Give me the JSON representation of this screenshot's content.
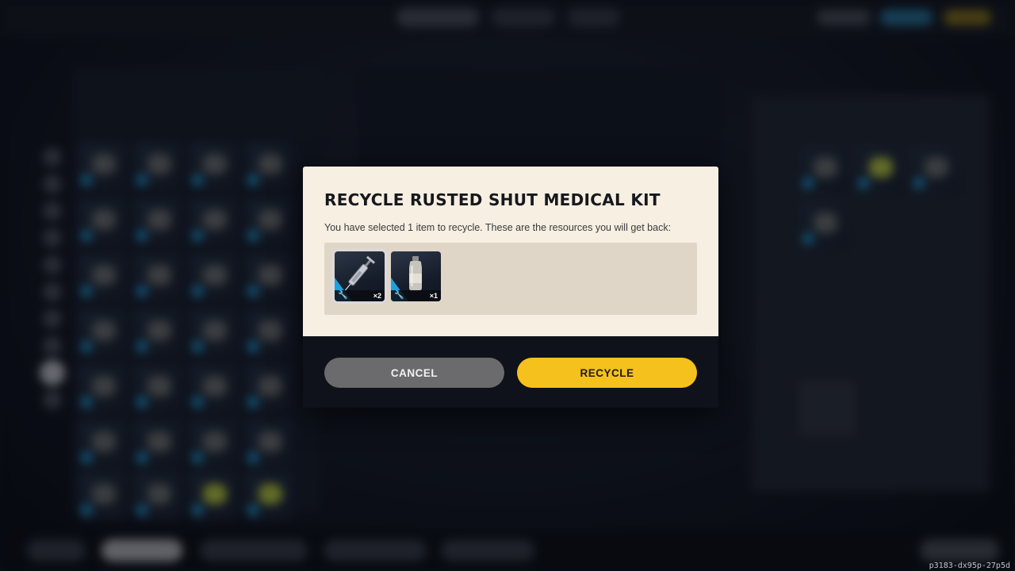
{
  "dialog": {
    "title": "RECYCLE RUSTED SHUT MEDICAL KIT",
    "description": "You have selected 1 item to recycle. These are the resources you will get back:",
    "resources": [
      {
        "icon": "syringe-icon",
        "quantity": "×2",
        "category_icon": "wrench-icon"
      },
      {
        "icon": "bottle-icon",
        "quantity": "×1",
        "category_icon": "wrench-icon"
      }
    ],
    "cancel_label": "CANCEL",
    "recycle_label": "RECYCLE"
  },
  "watermark": "p3183-dx95p-27p5d",
  "colors": {
    "dialog_background": "#f6efe2",
    "resource_box": "#e0d6c8",
    "footer": "#0f121a",
    "cancel_button": "#6b6b6d",
    "recycle_button": "#f5c11c",
    "rarity_corner": "#1aa3e0"
  }
}
